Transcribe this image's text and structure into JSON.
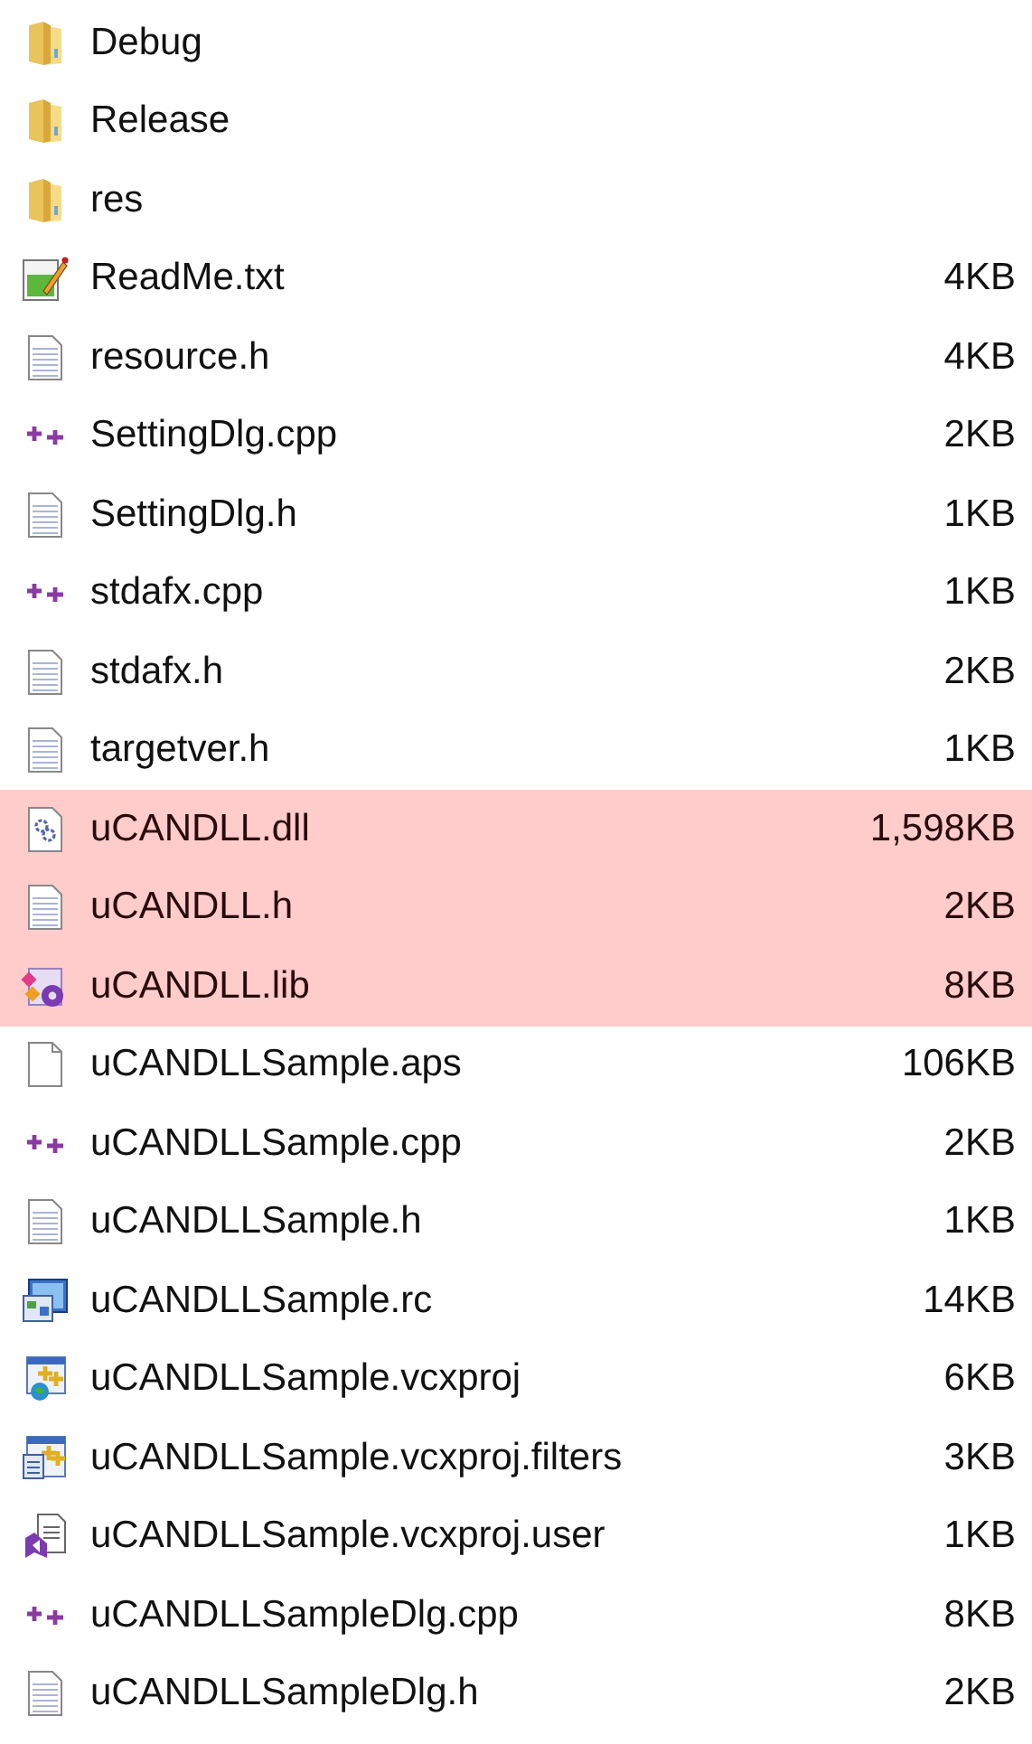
{
  "files": [
    {
      "name": "Debug",
      "kind": "folder",
      "selected": false
    },
    {
      "name": "Release",
      "kind": "folder",
      "selected": false
    },
    {
      "name": "res",
      "kind": "folder",
      "selected": false
    },
    {
      "name": "ReadMe.txt",
      "kind": "notepad",
      "size": "4KB",
      "selected": false
    },
    {
      "name": "resource.h",
      "kind": "text",
      "size": "4KB",
      "selected": false
    },
    {
      "name": "SettingDlg.cpp",
      "kind": "cpp",
      "size": "2KB",
      "selected": false
    },
    {
      "name": "SettingDlg.h",
      "kind": "text",
      "size": "1KB",
      "selected": false
    },
    {
      "name": "stdafx.cpp",
      "kind": "cpp",
      "size": "1KB",
      "selected": false
    },
    {
      "name": "stdafx.h",
      "kind": "text",
      "size": "2KB",
      "selected": false
    },
    {
      "name": "targetver.h",
      "kind": "text",
      "size": "1KB",
      "selected": false
    },
    {
      "name": "uCANDLL.dll",
      "kind": "dll",
      "size": "1,598KB",
      "selected": true
    },
    {
      "name": "uCANDLL.h",
      "kind": "text",
      "size": "2KB",
      "selected": true
    },
    {
      "name": "uCANDLL.lib",
      "kind": "lib",
      "size": "8KB",
      "selected": true
    },
    {
      "name": "uCANDLLSample.aps",
      "kind": "blank",
      "size": "106KB",
      "selected": false
    },
    {
      "name": "uCANDLLSample.cpp",
      "kind": "cpp",
      "size": "2KB",
      "selected": false
    },
    {
      "name": "uCANDLLSample.h",
      "kind": "text",
      "size": "1KB",
      "selected": false
    },
    {
      "name": "uCANDLLSample.rc",
      "kind": "rc",
      "size": "14KB",
      "selected": false
    },
    {
      "name": "uCANDLLSample.vcxproj",
      "kind": "vcxproj",
      "size": "6KB",
      "selected": false
    },
    {
      "name": "uCANDLLSample.vcxproj.filters",
      "kind": "filters",
      "size": "3KB",
      "selected": false
    },
    {
      "name": "uCANDLLSample.vcxproj.user",
      "kind": "user",
      "size": "1KB",
      "selected": false
    },
    {
      "name": "uCANDLLSampleDlg.cpp",
      "kind": "cpp",
      "size": "8KB",
      "selected": false
    },
    {
      "name": "uCANDLLSampleDlg.h",
      "kind": "text",
      "size": "2KB",
      "selected": false
    }
  ]
}
